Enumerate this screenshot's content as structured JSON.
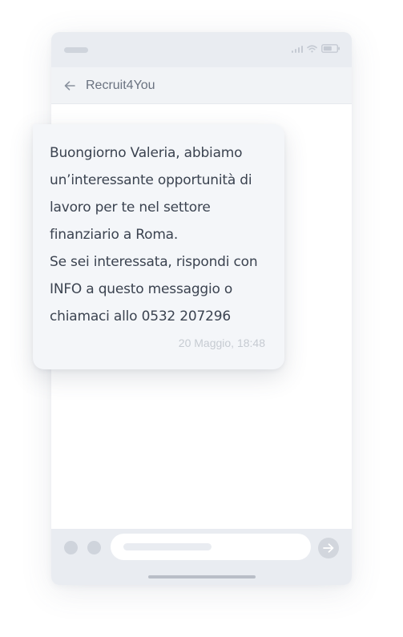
{
  "header": {
    "title": "Recruit4You",
    "back_icon": "arrow-left-icon"
  },
  "status_bar": {
    "icons": [
      "signal-icon",
      "wifi-icon",
      "battery-icon"
    ]
  },
  "message": {
    "lines": [
      "Buongiorno Valeria, abbiamo",
      "un’interessante opportunità di",
      "lavoro per te nel settore",
      "finanziario a Roma.",
      "Se sei interessata, rispondi con",
      "INFO a questo messaggio o",
      "chiamaci allo 0532 207296"
    ],
    "timestamp": "20 Maggio, 18:48"
  },
  "composer": {
    "send_icon": "arrow-right-icon"
  },
  "colors": {
    "chrome": "#e9ecf1",
    "bubble": "#f4f6f9",
    "text": "#3b4350",
    "muted": "#c6cbd2"
  }
}
